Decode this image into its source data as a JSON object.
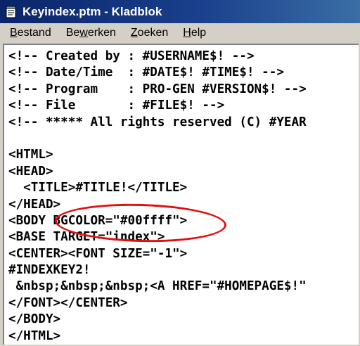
{
  "window": {
    "title": "Keyindex.ptm - Kladblok"
  },
  "menu": [
    {
      "accel": "B",
      "rest": "estand"
    },
    {
      "pre": "Be",
      "accel": "w",
      "rest": "erken"
    },
    {
      "accel": "Z",
      "rest": "oeken"
    },
    {
      "accel": "H",
      "rest": "elp"
    }
  ],
  "lines": [
    "<!-- Created by : #USERNAME$! -->",
    "<!-- Date/Time  : #DATE$! #TIME$! -->",
    "<!-- Program    : PRO-GEN #VERSION$! -->",
    "<!-- File       : #FILE$! -->",
    "<!-- ***** All rights reserved (C) #YEAR",
    "",
    "<HTML>",
    "<HEAD>",
    "  <TITLE>#TITLE!</TITLE>",
    "</HEAD>",
    "<BODY BGCOLOR=\"#00ffff\">",
    "<BASE TARGET=\"index\">",
    "<CENTER><FONT SIZE=\"-1\">",
    "#INDEXKEY2!",
    " &nbsp;&nbsp;&nbsp;<A HREF=\"#HOMEPAGE$!\"",
    "</FONT></CENTER>",
    "</BODY>",
    "</HTML>"
  ],
  "colors": {
    "titlebar": "#0a246a",
    "annotation": "#e01010"
  }
}
